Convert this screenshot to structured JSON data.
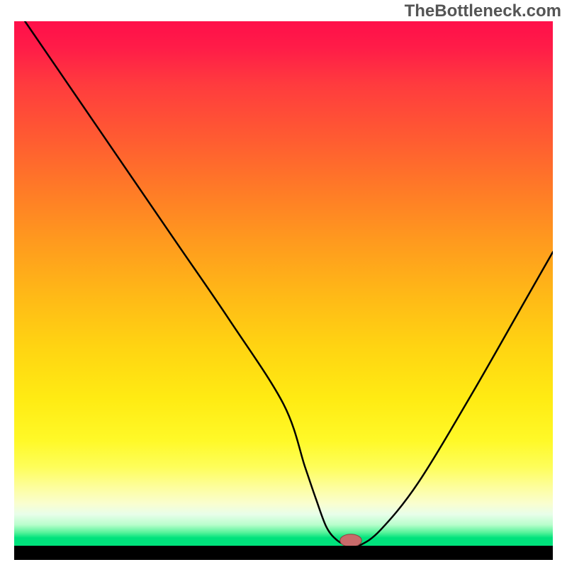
{
  "watermark": {
    "text": "TheBottleneck.com"
  },
  "colors": {
    "frame": "#000000",
    "curve": "#000000",
    "marker_fill": "#c86a6a",
    "marker_stroke": "#8d4242",
    "gradient_top": "#ff0f4a",
    "gradient_mid": "#ffeb13",
    "gradient_bottom": "#00e27c"
  },
  "chart_data": {
    "type": "line",
    "title": "",
    "xlabel": "",
    "ylabel": "",
    "x_range": [
      0,
      100
    ],
    "y_range": [
      0,
      100
    ],
    "series": [
      {
        "name": "bottleneck-curve",
        "type": "line",
        "x": [
          2,
          10,
          20,
          30,
          40,
          50,
          54,
          56,
          58,
          60,
          62,
          64,
          68,
          75,
          85,
          95,
          100
        ],
        "y": [
          100,
          88,
          73,
          58,
          43,
          27,
          15,
          9,
          3.5,
          1,
          0,
          0,
          3,
          12,
          29,
          47,
          56
        ]
      }
    ],
    "marker": {
      "name": "optimal-point",
      "x": 62.5,
      "y": 1.0,
      "rx": 2.0,
      "ry": 1.2
    },
    "legend": false,
    "grid": false
  }
}
